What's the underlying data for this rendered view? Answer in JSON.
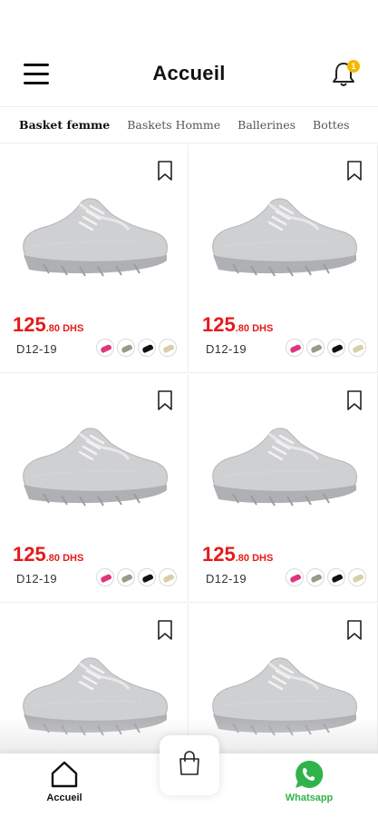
{
  "header": {
    "title": "Accueil",
    "notification_count": "1"
  },
  "tabs": [
    "Basket femme",
    "Baskets Homme",
    "Ballerines",
    "Bottes"
  ],
  "products": [
    {
      "price_int": "125",
      "price_dec": ".80 DHS",
      "ref": "D12-19",
      "colors": [
        "#e0357e",
        "#9a9a8a",
        "#111111",
        "#d8cfa6"
      ]
    },
    {
      "price_int": "125",
      "price_dec": ".80 DHS",
      "ref": "D12-19",
      "colors": [
        "#e0357e",
        "#9a9a8a",
        "#111111",
        "#d8cfa6"
      ]
    },
    {
      "price_int": "125",
      "price_dec": ".80 DHS",
      "ref": "D12-19",
      "colors": [
        "#e0357e",
        "#9a9a8a",
        "#111111",
        "#d8cfa6"
      ]
    },
    {
      "price_int": "125",
      "price_dec": ".80 DHS",
      "ref": "D12-19",
      "colors": [
        "#e0357e",
        "#9a9a8a",
        "#111111",
        "#d8cfa6"
      ]
    },
    {
      "price_int": "",
      "price_dec": "",
      "ref": "",
      "colors": []
    },
    {
      "price_int": "",
      "price_dec": "",
      "ref": "",
      "colors": []
    }
  ],
  "bottom_nav": {
    "home_label": "Accueil",
    "whatsapp_label": "Whatsapp"
  },
  "colors": {
    "price": "#e41b1b",
    "whatsapp": "#2fb34a",
    "badge": "#f5b800"
  },
  "icons": [
    "menu-icon",
    "bell-icon",
    "bookmark-icon",
    "home-icon",
    "shopping-bag-icon",
    "whatsapp-icon"
  ]
}
